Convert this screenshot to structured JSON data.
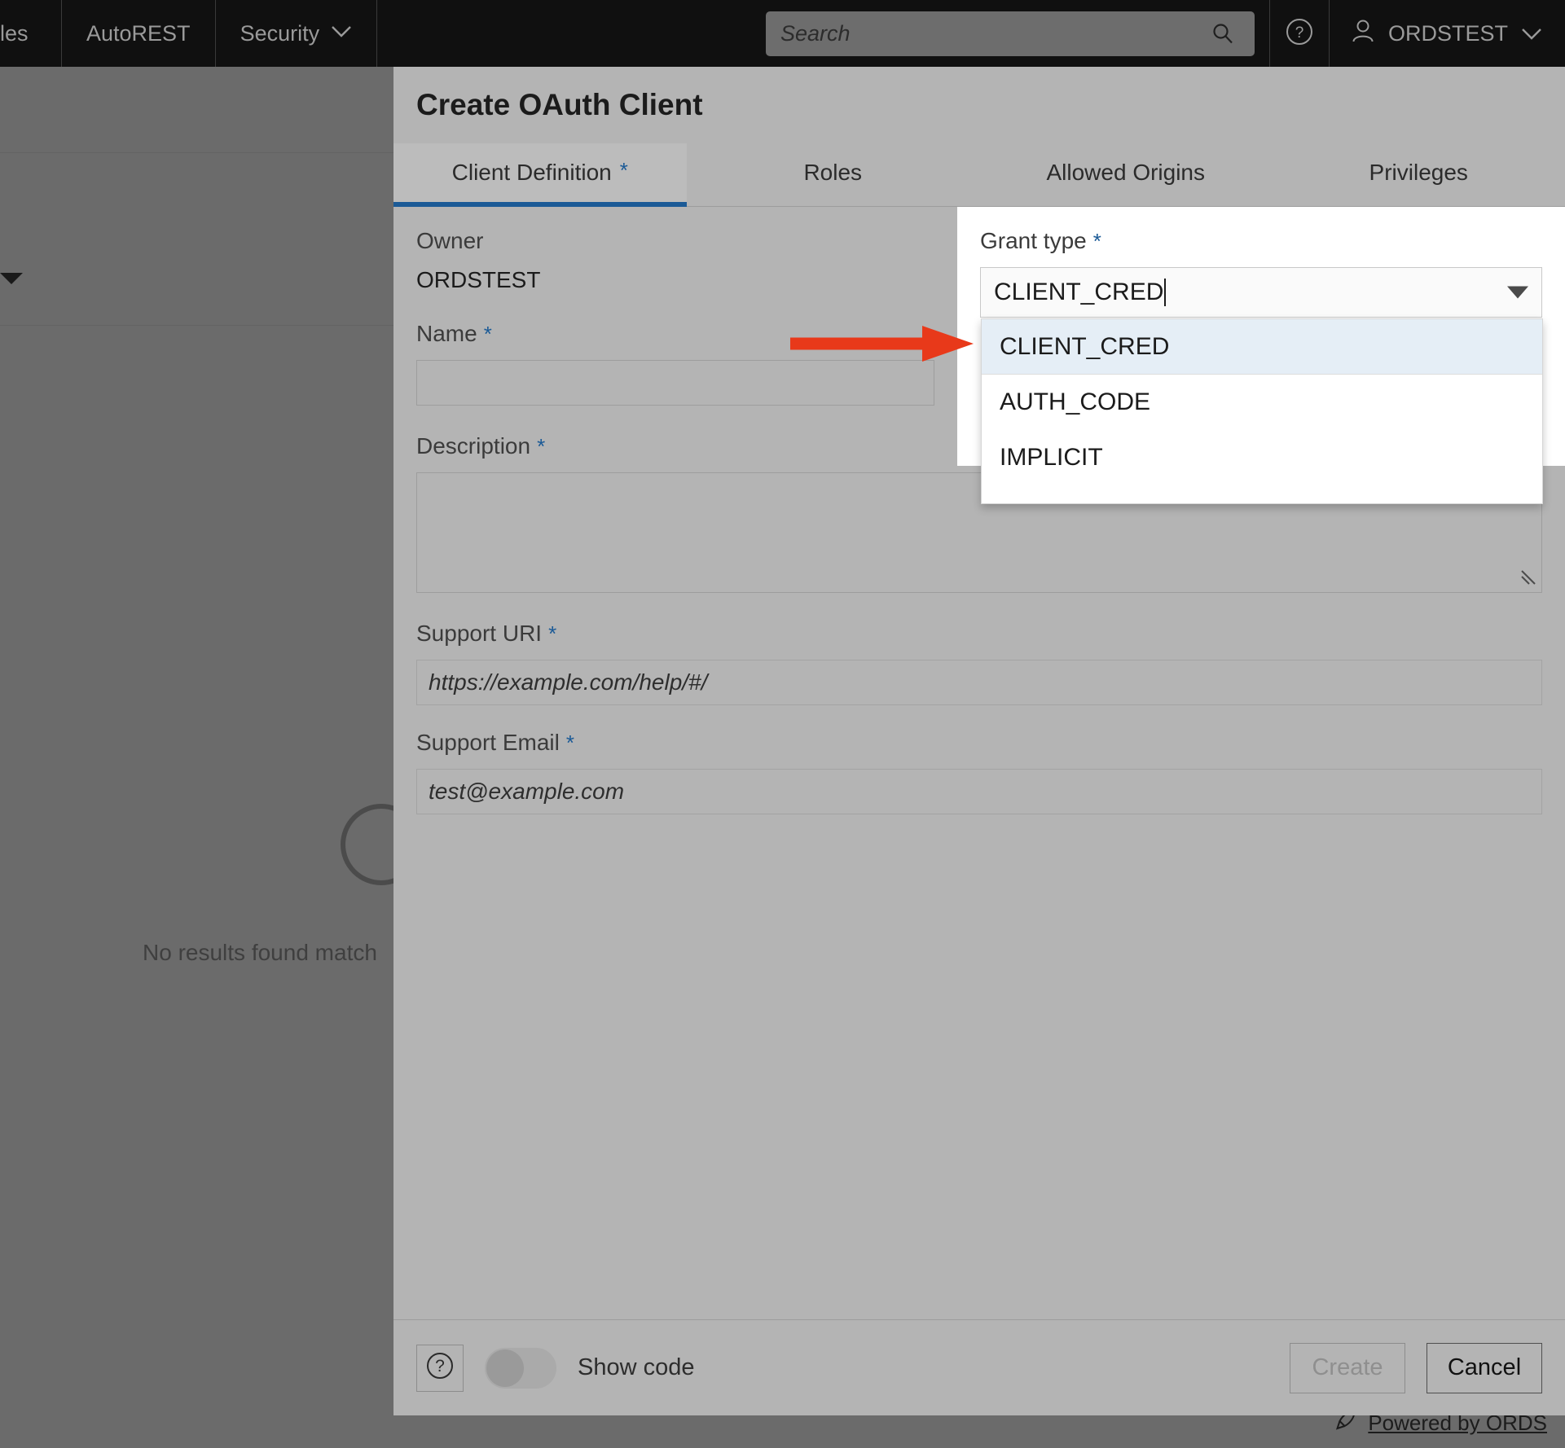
{
  "topbar": {
    "nav_items": [
      {
        "label": "les",
        "has_caret": false
      },
      {
        "label": "AutoREST",
        "has_caret": false
      },
      {
        "label": "Security",
        "has_caret": true
      }
    ],
    "search": {
      "placeholder": "Search",
      "value": ""
    },
    "help_icon": "help-circle-icon",
    "user": {
      "name": "ORDSTEST",
      "icon": "user-icon",
      "caret": "∨"
    },
    "background": "#101010",
    "text_color": "#9a9a9a"
  },
  "backdrop": {
    "no_results_text": "No results found match",
    "spinner": "loading-spinner",
    "powered_by": "Powered by ORDS",
    "rocket_icon": "rocket-icon"
  },
  "dialog": {
    "title": "Create OAuth Client",
    "tabs": [
      {
        "label": "Client Definition",
        "required": "*",
        "active": true
      },
      {
        "label": "Roles",
        "required": "",
        "active": false
      },
      {
        "label": "Allowed Origins",
        "required": "",
        "active": false
      },
      {
        "label": "Privileges",
        "required": "",
        "active": false
      }
    ],
    "accent_color": "#1b5a96",
    "fields": {
      "owner": {
        "label": "Owner",
        "value": "ORDSTEST"
      },
      "name": {
        "label": "Name",
        "required": "*",
        "value": "",
        "placeholder": ""
      },
      "description": {
        "label": "Description",
        "required": "*",
        "value": "",
        "placeholder": ""
      },
      "support_uri": {
        "label": "Support URI",
        "required": "*",
        "value": "",
        "placeholder": "https://example.com/help/#/"
      },
      "support_email": {
        "label": "Support Email",
        "required": "*",
        "value": "",
        "placeholder": "test@example.com"
      },
      "grant_type": {
        "label": "Grant type",
        "required": "*",
        "value": "CLIENT_CRED",
        "expanded": true,
        "options": [
          {
            "label": "CLIENT_CRED",
            "selected": true
          },
          {
            "label": "AUTH_CODE",
            "selected": false
          },
          {
            "label": "IMPLICIT",
            "selected": false
          }
        ]
      }
    },
    "footer": {
      "help_icon": "help-circle-icon",
      "show_code_label": "Show code",
      "show_code_on": false,
      "create_label": "Create",
      "create_disabled": true,
      "cancel_label": "Cancel"
    }
  },
  "annotation": {
    "arrow_color": "#e8391a",
    "arrow_points_to": "grant-type-dropdown"
  }
}
